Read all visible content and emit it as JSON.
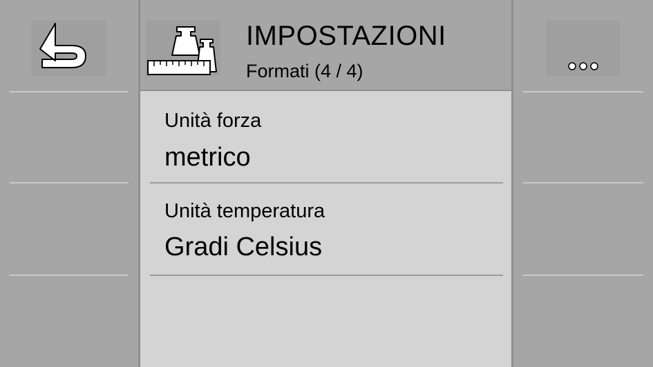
{
  "header": {
    "title": "IMPOSTAZIONI",
    "subtitle": "Formati (4 / 4)",
    "icon": "weights-ruler-icon"
  },
  "left_softkeys": {
    "back_icon": "back-arrow-icon"
  },
  "right_softkeys": {
    "more_label": "○○○",
    "more_icon": "more-dots-icon"
  },
  "settings": {
    "items": [
      {
        "label": "Unità forza",
        "value": "metrico"
      },
      {
        "label": "Unità temperatura",
        "value": "Gradi Celsius"
      }
    ]
  },
  "colors": {
    "panel_bg": "#a6a6a6",
    "content_bg": "#d4d4d4",
    "icon_white": "#ffffff"
  }
}
